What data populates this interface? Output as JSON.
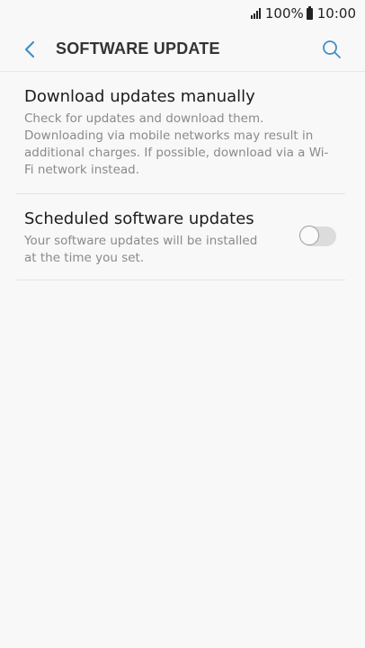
{
  "status_bar": {
    "battery_percent": "100%",
    "time": "10:00",
    "icons": [
      "signal-icon",
      "battery-icon"
    ]
  },
  "header": {
    "title": "SOFTWARE UPDATE",
    "back_icon": "back-arrow-icon",
    "search_icon": "search-icon",
    "accent_color": "#3e91c6"
  },
  "items": [
    {
      "title": "Download updates manually",
      "description": "Check for updates and download them. Downloading via mobile networks may result in additional charges. If possible, download via a Wi-Fi network instead."
    },
    {
      "title": "Scheduled software updates",
      "description": "Your software updates will be installed at the time you set.",
      "toggle_state": "off"
    }
  ]
}
